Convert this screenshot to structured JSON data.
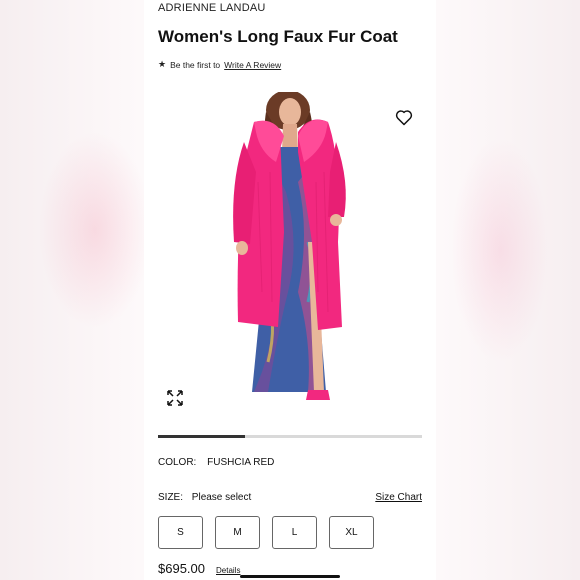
{
  "product": {
    "brand": "ADRIENNE LANDAU",
    "title": "Women's Long Faux Fur Coat",
    "review_prompt": "Be the first to",
    "review_link": "Write A Review"
  },
  "gallery": {
    "image_progress": 0.33,
    "icons": {
      "wishlist": "heart-icon",
      "expand": "expand-icon",
      "rating": "star-icon"
    },
    "colors": {
      "coat": "#f2287f",
      "dress": "#3f5fa6",
      "skin": "#e8b79a",
      "hair": "#6b3b26"
    }
  },
  "color": {
    "label": "COLOR:",
    "value": "FUSHCIA RED"
  },
  "size": {
    "label": "SIZE:",
    "selection": "Please select",
    "chart_link": "Size Chart",
    "options": [
      "S",
      "M",
      "L",
      "XL"
    ]
  },
  "pricing": {
    "price": "$695.00",
    "details_link": "Details"
  }
}
